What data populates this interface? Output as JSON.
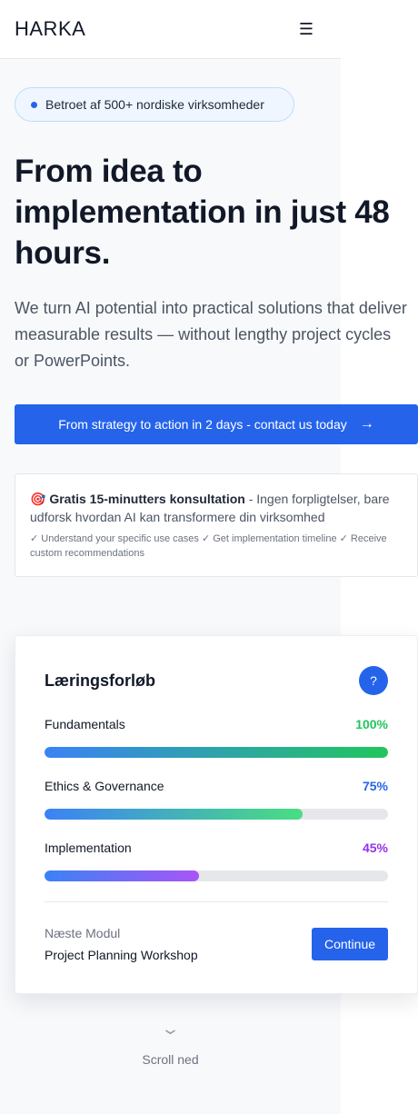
{
  "header": {
    "logo": "HARKA",
    "menu_icon": "☰"
  },
  "badge": {
    "text": "Betroet af 500+ nordiske virksomheder"
  },
  "hero": {
    "title": "From idea to implementation in just 48 hours.",
    "subtitle": "We turn AI potential into practical solutions that deliver measurable results — without lengthy project cycles or PowerPoints."
  },
  "cta": {
    "label": "From strategy to action in 2 days - contact us today",
    "arrow": "→"
  },
  "consult": {
    "emoji": "🎯",
    "bold": "Gratis 15-minutters konsultation",
    "text": " - Ingen forpligtelser, bare udforsk hvordan AI kan transformere din virksomhed",
    "checks": "✓ Understand your specific use cases ✓ Get implementation timeline ✓ Receive custom recommendations"
  },
  "learning": {
    "title": "Læringsforløb",
    "help_icon": "?",
    "items": [
      {
        "label": "Fundamentals",
        "value": "100%",
        "percent": 100,
        "color": "#22c55e",
        "gradient": [
          "#3b82f6",
          "#22c55e"
        ]
      },
      {
        "label": "Ethics & Governance",
        "value": "75%",
        "percent": 75,
        "color": "#2563eb",
        "gradient": [
          "#3b82f6",
          "#4ade80"
        ]
      },
      {
        "label": "Implementation",
        "value": "45%",
        "percent": 45,
        "color": "#9333ea",
        "gradient": [
          "#3b82f6",
          "#a855f7"
        ]
      }
    ],
    "next_label": "Næste Modul",
    "next_name": "Project Planning Workshop",
    "continue_label": "Continue"
  },
  "scroll": {
    "icon": "⌄",
    "label": "Scroll ned"
  }
}
